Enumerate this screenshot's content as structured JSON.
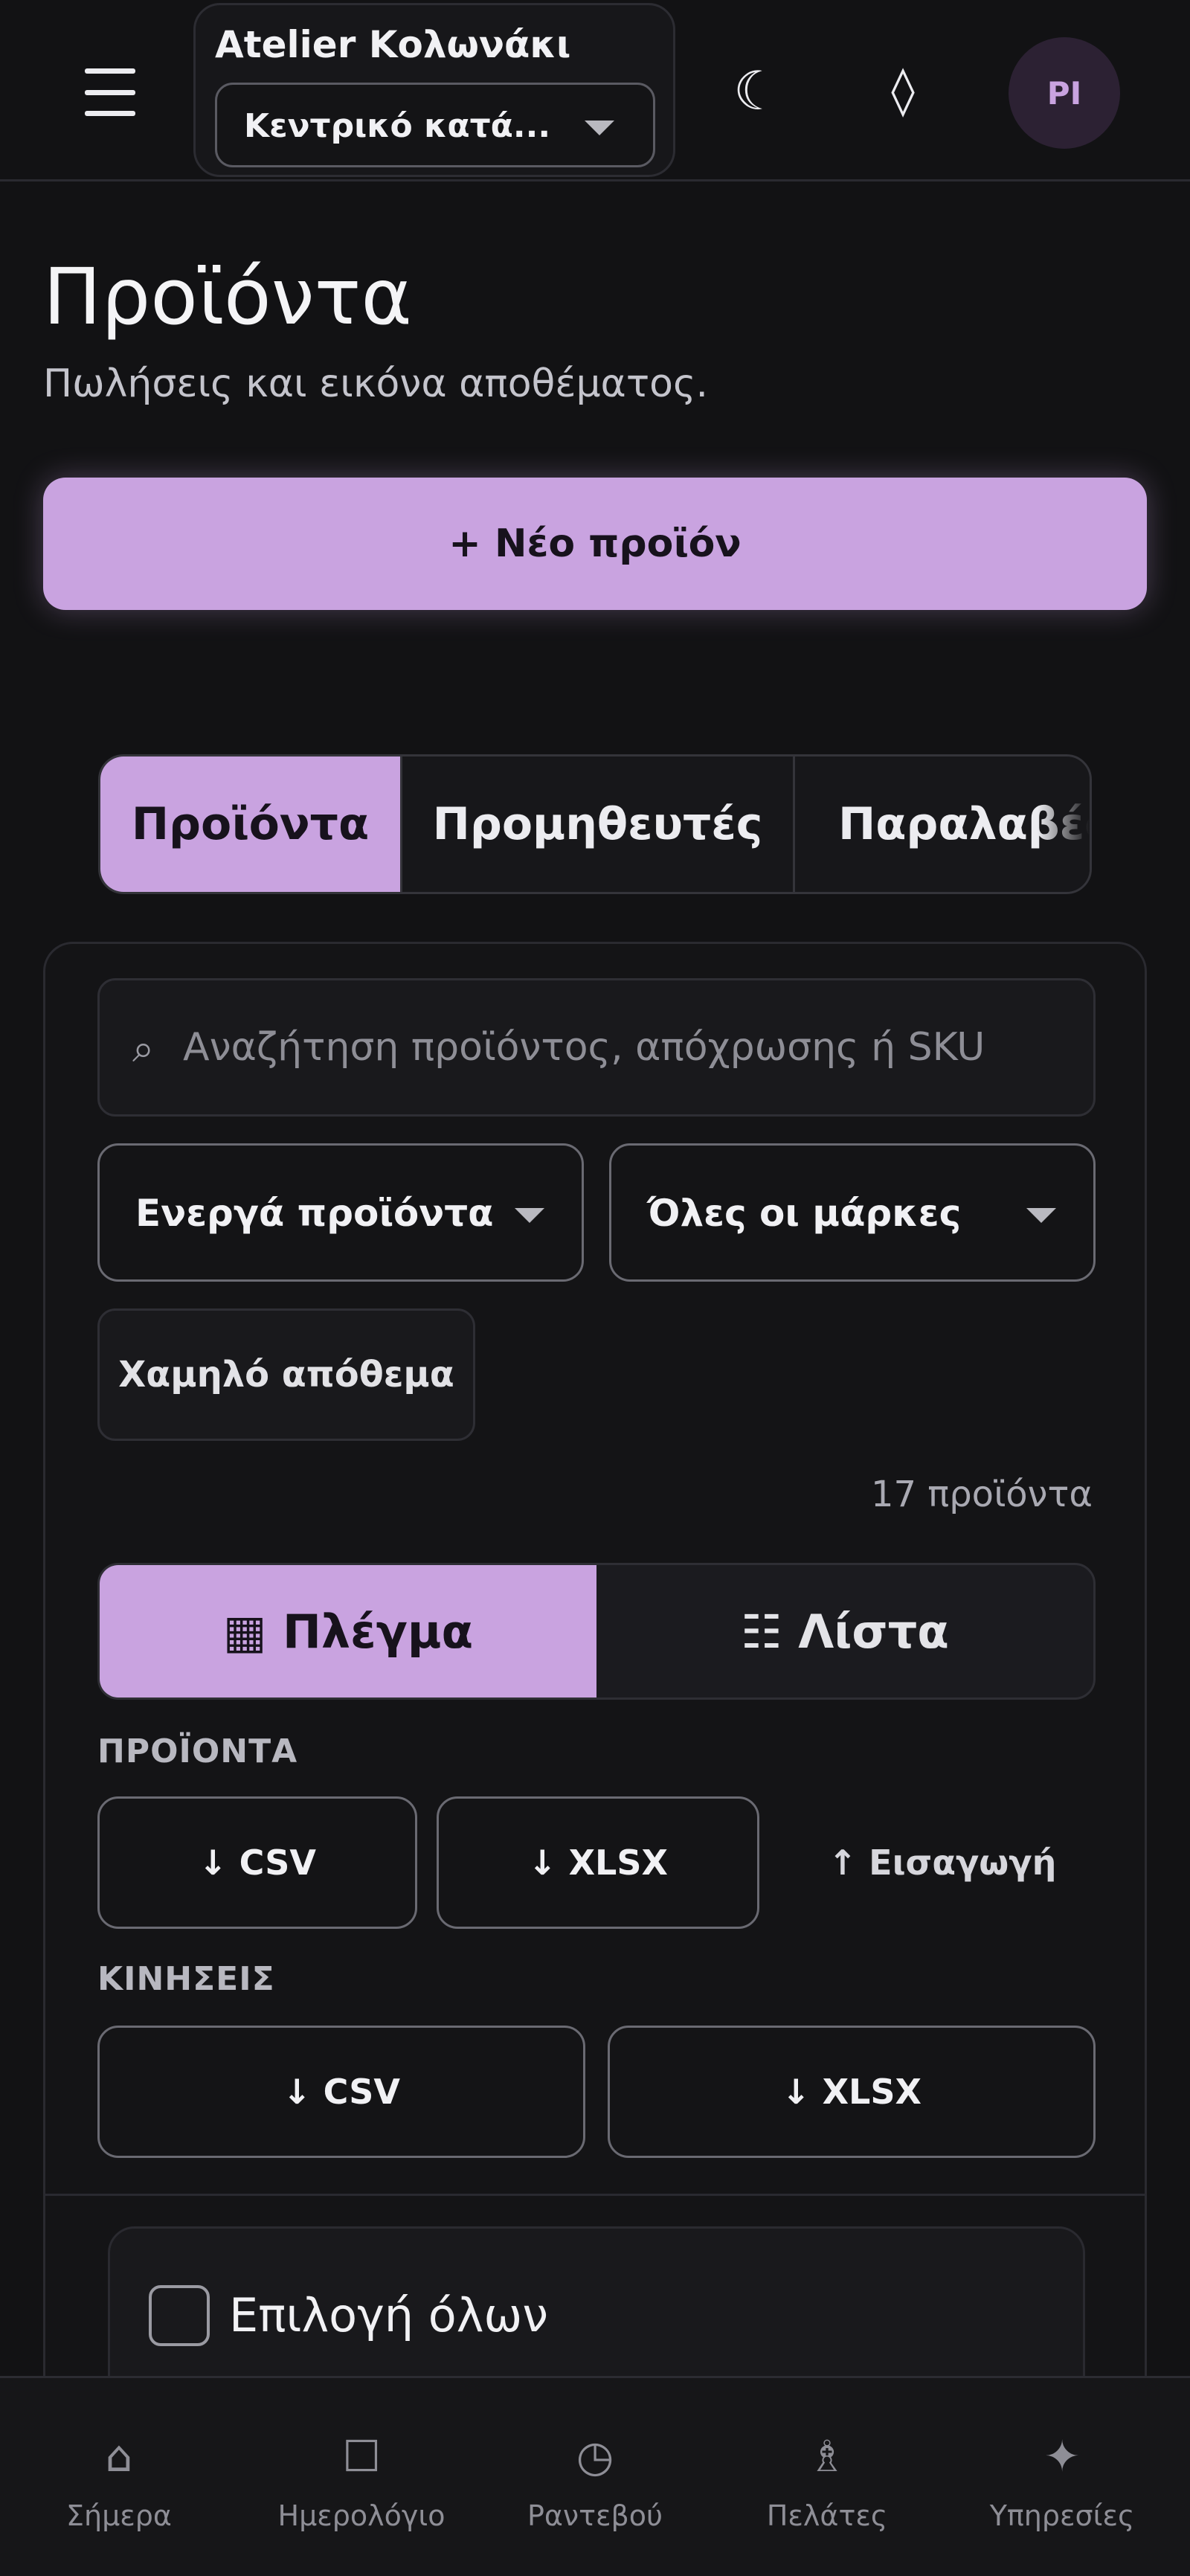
{
  "header": {
    "studio_name": "Atelier Κολωνάκι",
    "branch": "Κεντρικό κατά...",
    "avatar_initials": "PI"
  },
  "page": {
    "title": "Προϊόντα",
    "subtitle": "Πωλήσεις και εικόνα αποθέματος.",
    "new_button": "+ Νέο προϊόν"
  },
  "tabs": [
    {
      "label": "Προϊόντα",
      "active": true
    },
    {
      "label": "Προμηθευτές",
      "active": false
    },
    {
      "label": "Παραλαβές",
      "active": false
    }
  ],
  "filters": {
    "search_placeholder": "Αναζήτηση προϊόντος, απόχρωσης ή SKU",
    "status_select": "Ενεργά προϊόντα",
    "brand_select": "Όλες οι μάρκες",
    "low_stock_chip": "Χαμηλό απόθεμα",
    "count": "17 προϊόντα"
  },
  "view_toggle": {
    "grid_label": "▦ Πλέγμα",
    "list_label": "☷ Λίστα",
    "active": "grid"
  },
  "exports": {
    "products_label": "ΠΡΟΪΟΝΤΑ",
    "products_csv": "↓ CSV",
    "products_xlsx": "↓ XLSX",
    "import": "↑ Εισαγωγή",
    "movements_label": "ΚΙΝΗΣΕΙΣ",
    "movements_csv": "↓ CSV",
    "movements_xlsx": "↓ XLSX"
  },
  "selection": {
    "select_all": "Επιλογή όλων"
  },
  "bottom_nav": [
    {
      "label": "Σήμερα",
      "icon": "home-icon"
    },
    {
      "label": "Ημερολόγιο",
      "icon": "calendar-icon"
    },
    {
      "label": "Ραντεβού",
      "icon": "clock-icon"
    },
    {
      "label": "Πελάτες",
      "icon": "person-icon"
    },
    {
      "label": "Υπηρεσίες",
      "icon": "sparkle-icon"
    }
  ],
  "colors": {
    "accent": "#c9a3e0",
    "background": "#121214",
    "surface": "#141416"
  }
}
